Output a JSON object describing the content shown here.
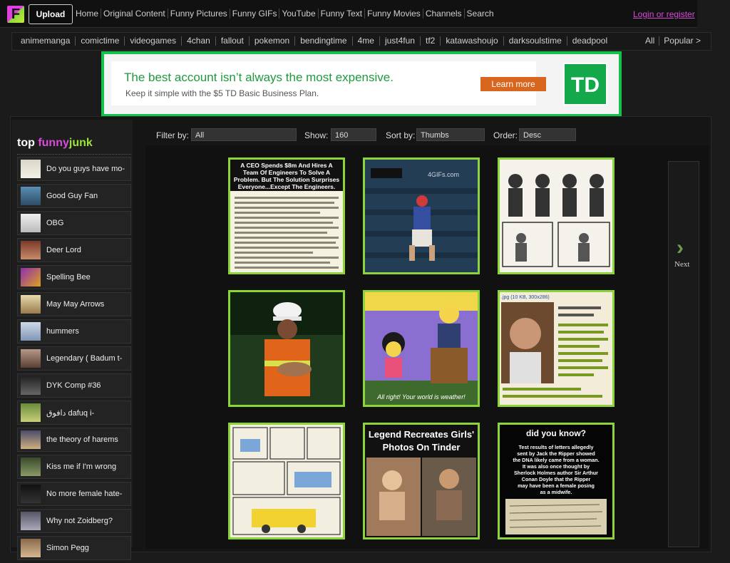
{
  "header": {
    "upload_label": "Upload",
    "nav": [
      "Home",
      "Original Content",
      "Funny Pictures",
      "Funny GIFs",
      "YouTube",
      "Funny Text",
      "Funny Movies",
      "Channels",
      "Search"
    ],
    "login": "Login or register"
  },
  "channels": {
    "items": [
      "animemanga",
      "comictime",
      "videogames",
      "4chan",
      "fallout",
      "pokemon",
      "bendingtime",
      "4me",
      "just4fun",
      "tf2",
      "katawashoujo",
      "darksoulstime",
      "deadpool"
    ],
    "all": "All",
    "popular": "Popular >"
  },
  "ad": {
    "headline": "The best account isn’t always the most expensive.",
    "subline": "Keep it simple with the $5 TD Basic Business Plan.",
    "cta": "Learn more",
    "logo": "TD"
  },
  "sidebar": {
    "title_top": "top",
    "title_funny": "funny",
    "title_junk": "junk",
    "items": [
      "Do you guys have mo-",
      "Good Guy Fan",
      "OBG",
      "Deer Lord",
      "Spelling Bee",
      "May May Arrows",
      "hummers",
      "Legendary ( Badum t-",
      "DYK Comp #36",
      "دافوق dafuq i-",
      "the theory of harems",
      "Kiss me if I'm wrong",
      "No more female hate-",
      "Why not Zoidberg?",
      "Simon Pegg"
    ]
  },
  "filters": {
    "filter_label": "Filter by:",
    "filter_value": "All",
    "show_label": "Show:",
    "show_value": "160",
    "sort_label": "Sort by:",
    "sort_value": "Thumbs",
    "order_label": "Order:",
    "order_value": "Desc"
  },
  "thumbs": {
    "t1_lines": [
      "A CEO Spends $8m And Hires A",
      "Team Of Engineers To Solve A",
      "Problem. But The Solution Surprises",
      "Everyone...Except The Engineers."
    ],
    "t2_text": "4GIFs.com",
    "t5_text": "All right!  Your world is weather!",
    "t6_text": ".jpg (10 KB, 300x286)",
    "t7_title1": "Legend Recreates Girls'",
    "t7_title2": "Photos On Tinder",
    "t8_title": "did you know?",
    "t8_lines": [
      "Test results of letters allegedly",
      "sent by Jack the Ripper showed",
      "the DNA likely came from a woman.",
      "It was also once thought by",
      "Sherlock Holmes author Sir Arthur",
      "Conan Doyle that the Ripper",
      "may have been a female posing",
      "as a midwife."
    ]
  },
  "next_label": "Next",
  "colors": {
    "accent_green": "#8cd43a",
    "brand_pink": "#d94cd9",
    "ad_green": "#14c14a"
  }
}
